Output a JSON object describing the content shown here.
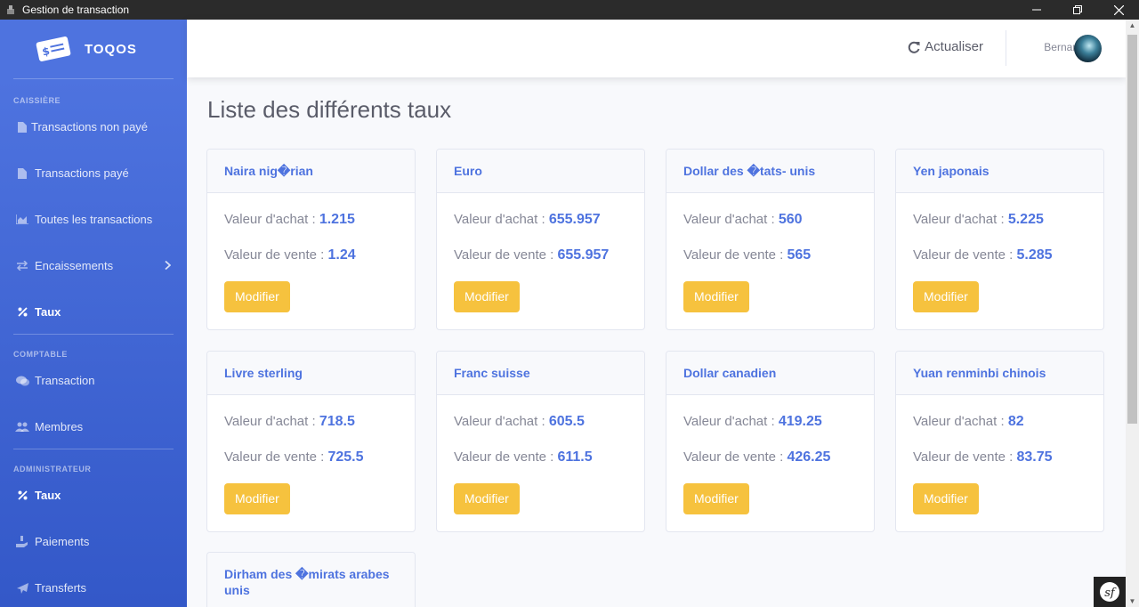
{
  "window": {
    "title": "Gestion de transaction"
  },
  "brand": {
    "name": "TOQOS"
  },
  "sidebar": {
    "caissiere_heading": "CAISSIÈRE",
    "caissiere_items": [
      {
        "label": "Transactions non payé",
        "icon": "file-icon"
      },
      {
        "label": "Transactions payé",
        "icon": "file-icon"
      },
      {
        "label": "Toutes les transactions",
        "icon": "chart-area-icon"
      },
      {
        "label": "Encaissements",
        "icon": "exchange-icon"
      },
      {
        "label": "Taux",
        "icon": "percent-icon"
      }
    ],
    "comptable_heading": "COMPTABLE",
    "comptable_items": [
      {
        "label": "Transaction",
        "icon": "comments-icon"
      },
      {
        "label": "Membres",
        "icon": "users-icon"
      }
    ],
    "admin_heading": "ADMINISTRATEUR",
    "admin_items": [
      {
        "label": "Taux",
        "icon": "percent-icon"
      },
      {
        "label": "Paiements",
        "icon": "hand-holding-icon"
      },
      {
        "label": "Transferts",
        "icon": "paper-plane-icon"
      }
    ]
  },
  "topbar": {
    "refresh_label": "Actualiser",
    "user_name": "Bernard"
  },
  "main": {
    "title": "Liste des différents taux",
    "buy_label": "Valeur d'achat : ",
    "sell_label": "Valeur de vente : ",
    "button_label": "Modifier",
    "rates": [
      {
        "currency": "Naira nig�rian",
        "buy": "1.215",
        "sell": "1.24"
      },
      {
        "currency": "Euro",
        "buy": "655.957",
        "sell": "655.957"
      },
      {
        "currency": "Dollar des �tats- unis",
        "buy": "560",
        "sell": "565"
      },
      {
        "currency": "Yen japonais",
        "buy": "5.225",
        "sell": "5.285"
      },
      {
        "currency": "Livre sterling",
        "buy": "718.5",
        "sell": "725.5"
      },
      {
        "currency": "Franc suisse",
        "buy": "605.5",
        "sell": "611.5"
      },
      {
        "currency": "Dollar canadien",
        "buy": "419.25",
        "sell": "426.25"
      },
      {
        "currency": "Yuan renminbi chinois",
        "buy": "82",
        "sell": "83.75"
      },
      {
        "currency": "Dirham des �mirats arabes unis"
      }
    ]
  },
  "colors": {
    "sidebar": "#4e73df",
    "accent": "#4e73df",
    "button": "#f6c23e",
    "text_muted": "#858796"
  }
}
